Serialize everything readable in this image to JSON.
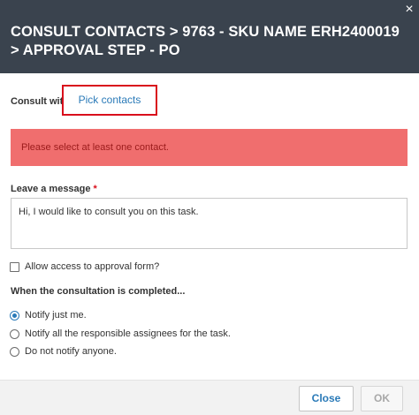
{
  "dialog": {
    "title": "CONSULT CONTACTS > 9763 - SKU NAME ERH2400019 > APPROVAL STEP - PO",
    "close_glyph": "×"
  },
  "consult": {
    "label": "Consult with",
    "pick_button": "Pick contacts"
  },
  "alert": {
    "message": "Please select at least one contact."
  },
  "message": {
    "label": "Leave a message",
    "required_marker": "*",
    "value": "Hi, I would like to consult you on this task."
  },
  "access": {
    "label": "Allow access to approval form?",
    "checked": false
  },
  "completion": {
    "label": "When the consultation is completed...",
    "options": [
      {
        "label": "Notify just me.",
        "checked": true
      },
      {
        "label": "Notify all the responsible assignees for the task.",
        "checked": false
      },
      {
        "label": "Do not notify anyone.",
        "checked": false
      }
    ]
  },
  "footer": {
    "close_label": "Close",
    "ok_label": "OK"
  },
  "colors": {
    "header_bg": "#3a434e",
    "accent_blue": "#2a7ab8",
    "alert_bg": "#f06e6e",
    "highlight_red": "#d90f1c"
  }
}
